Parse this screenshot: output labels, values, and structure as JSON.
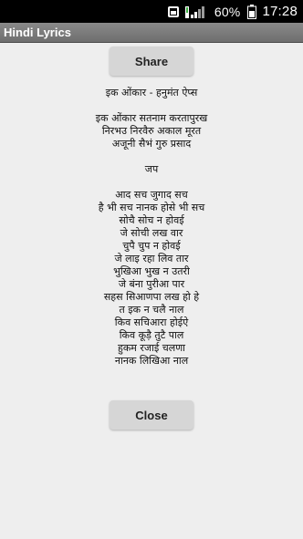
{
  "status_bar": {
    "battery": "60%",
    "time": "17:28",
    "icons": [
      "notification-icon",
      "signal-icon",
      "battery-icon"
    ]
  },
  "app": {
    "title": "Hindi Lyrics"
  },
  "buttons": {
    "share": "Share",
    "close": "Close"
  },
  "lyrics": {
    "heading": "इक ओंकार  - हनुमंत ऐप्स",
    "stanza1": [
      "इक ओंकार  सतनाम करतापुरख",
      "निरभउ निरवैरु अकाल मूरत",
      "अजूनी सैभं गुरु प्रसाद"
    ],
    "section": "जप",
    "stanza2": [
      "आद सच जुगाद सच",
      "है भी सच नानक होसे भी सच",
      "सोचै सोच न होवई",
      "जे सोची लख वार",
      "चुपै चुप न होवई",
      "जे लाइ रहा लिव तार",
      "भुखिआ भुख न उतरी",
      "जे बंना पुरीआ पार",
      "सहस सिआणपा लख हो हे",
      "त इक न चलै नाल",
      "किव सचिआरा होईऐ",
      "किव कूड़ै तुटै पाल",
      "हुकम रजाई चलणा",
      "नानक लिखिआ नाल"
    ]
  }
}
